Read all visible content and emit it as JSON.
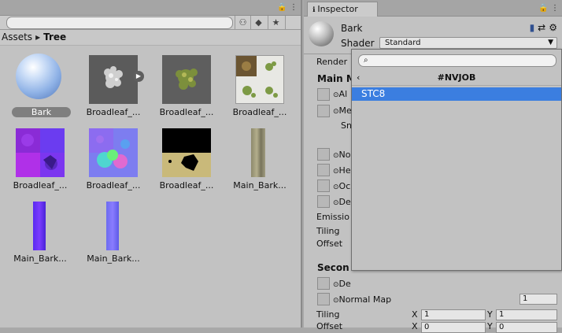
{
  "project": {
    "breadcrumb": [
      "Assets",
      "Tree"
    ],
    "breadcrumb_sep": "▸",
    "assets": [
      {
        "label": "Bark",
        "selected": true,
        "thumb": "sphere"
      },
      {
        "label": "Broadleaf_...",
        "selected": false,
        "thumb": "leaves-gray"
      },
      {
        "label": "Broadleaf_...",
        "selected": false,
        "thumb": "leaves-green"
      },
      {
        "label": "Broadleaf_...",
        "selected": false,
        "thumb": "leaves-atlas"
      },
      {
        "label": "Broadleaf_...",
        "selected": false,
        "thumb": "normal-blue"
      },
      {
        "label": "Broadleaf_...",
        "selected": false,
        "thumb": "normal-rainbow"
      },
      {
        "label": "Broadleaf_...",
        "selected": false,
        "thumb": "mask-black"
      },
      {
        "label": "Main_Bark...",
        "selected": false,
        "thumb": "bark-strip"
      },
      {
        "label": "Main_Bark...",
        "selected": false,
        "thumb": "bark-normal"
      },
      {
        "label": "Main_Bark...",
        "selected": false,
        "thumb": "bark-normal2"
      }
    ]
  },
  "inspector": {
    "tab_label": "Inspector",
    "material_name": "Bark",
    "shader_label": "Shader",
    "shader_value": "Standard",
    "render_label": "Render",
    "main_maps_label": "Main M",
    "props": [
      {
        "label": "Al"
      },
      {
        "label": "Me"
      },
      {
        "label": "Sn"
      },
      {
        "label": "No"
      },
      {
        "label": "He"
      },
      {
        "label": "Oc"
      },
      {
        "label": "De"
      }
    ],
    "emission_label": "Emissio",
    "tiling_label": "Tiling",
    "offset_label": "Offset",
    "secondary_label": "Secon",
    "sec_detail_label": "De",
    "normal_map_label": "Normal Map",
    "normal_map_value": "1",
    "sec_tiling_label": "Tiling",
    "sec_offset_label": "Offset",
    "x_label": "X",
    "y_label": "Y",
    "tiling_x": "1",
    "tiling_y": "1",
    "offset_x": "0",
    "offset_y": "0"
  },
  "popup": {
    "search_value": "",
    "header": "#NVJOB",
    "back": "‹",
    "items": [
      "STC8"
    ]
  },
  "colors": {
    "selection": "#3b7ee0",
    "panel": "#c2c2c2"
  }
}
